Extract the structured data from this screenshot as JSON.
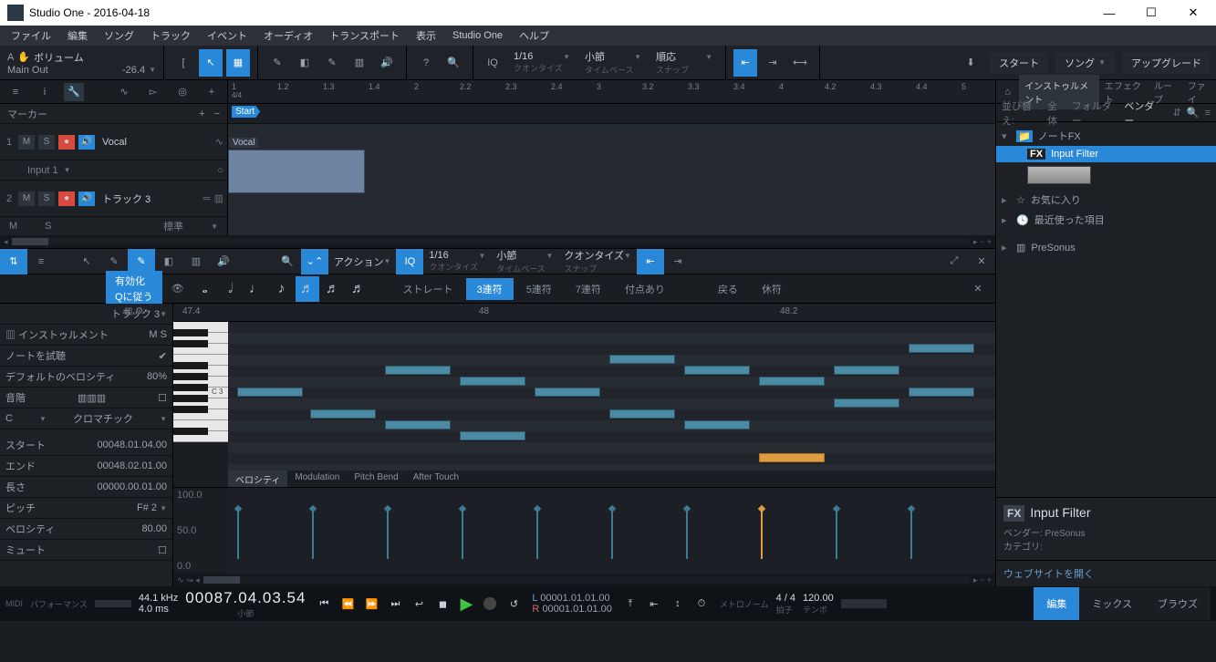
{
  "window": {
    "title": "Studio One - 2016-04-18"
  },
  "menu": [
    "ファイル",
    "編集",
    "ソング",
    "トラック",
    "イベント",
    "オーディオ",
    "トランスポート",
    "表示",
    "Studio One",
    "ヘルプ"
  ],
  "header_left": {
    "mode": "ボリューム",
    "out": "Main Out",
    "level": "-26.4"
  },
  "quantize": {
    "value": "1/16",
    "label": "クオンタイズ"
  },
  "timebase": {
    "value": "小節",
    "label": "タイムベース"
  },
  "snap": {
    "value": "順応",
    "label": "スナップ"
  },
  "top_right": {
    "start": "スタート",
    "song": "ソング",
    "upgrade": "アップグレード"
  },
  "marker": {
    "label": "マーカー",
    "start": "Start"
  },
  "tracks": [
    {
      "num": "1",
      "name": "Vocal",
      "input": "Input 1"
    },
    {
      "num": "2",
      "name": "トラック 3"
    }
  ],
  "track_footer": {
    "m": "M",
    "s": "S",
    "zoom": "標準"
  },
  "piano": {
    "action": "アクション",
    "q_value": "1/16",
    "q_label": "クオンタイズ",
    "tb_value": "小節",
    "tb_label": "タイムベース",
    "sn_value": "クオンタイズ",
    "sn_label": "スナップ",
    "enable": "有効化",
    "follow": "Qに従う",
    "trip": {
      "straight": "ストレート",
      "t3": "3連符",
      "t5": "5連符",
      "t7": "7連符",
      "dotted": "付点あり",
      "back": "戻る",
      "rest": "休符"
    },
    "track": "トラック 3",
    "ruler": {
      "a": "47.4",
      "b": "48",
      "c": "48.2"
    },
    "side": {
      "instr": "インストゥルメント",
      "preview": "ノートを試聴",
      "defvel": "デフォルトのベロシティ",
      "defvel_v": "80%",
      "scale": "音階",
      "c": "C",
      "chrom": "クロマチック",
      "start_l": "スタート",
      "start_v": "00048.01.04.00",
      "end_l": "エンド",
      "end_v": "00048.02.01.00",
      "len_l": "長さ",
      "len_v": "00000.00.01.00",
      "pitch_l": "ピッチ",
      "pitch_v": "F# 2",
      "vel_l": "ベロシティ",
      "vel_v": "80.00",
      "mute_l": "ミュート",
      "m": "M",
      "s": "S"
    },
    "vel_tabs": [
      "ベロシティ",
      "Modulation",
      "Pitch Bend",
      "After Touch"
    ],
    "vel_scale": {
      "a": "100.0",
      "b": "50.0",
      "c": "0.0"
    },
    "key_label": "C 3"
  },
  "browser": {
    "tabs": [
      "インストゥルメント",
      "エフェクト",
      "ループ",
      "ファイ"
    ],
    "sort": {
      "label": "並び替え:",
      "all": "全体",
      "folder": "フォルダー",
      "vendor": "ベンダー"
    },
    "node_fx": "ノートFX",
    "input_filter": "Input Filter",
    "fav": "お気に入り",
    "recent": "最近使った項目",
    "presonus": "PreSonus",
    "info": {
      "fx": "FX",
      "name": "Input Filter",
      "vendor": "ベンダー: PreSonus",
      "cat": "カテゴリ:"
    },
    "link": "ウェブサイトを開く"
  },
  "transport": {
    "midi": "MIDI",
    "perf": "パフォーマンス",
    "rate": "44.1 kHz",
    "lat": "4.0 ms",
    "pos": "00087.04.03.54",
    "pos_l": "小節",
    "l": "00001.01.01.00",
    "r": "00001.01.01.00",
    "metro": "メトロノーム",
    "sig": "4 / 4",
    "sig_l": "拍子",
    "tempo": "120.00",
    "tempo_l": "テンポ",
    "t_edit": "編集",
    "t_mix": "ミックス",
    "t_browse": "ブラウズ"
  },
  "ruler_ticks": [
    "1",
    "1.2",
    "1.3",
    "1.4",
    "2",
    "2.2",
    "2.3",
    "2.4",
    "3",
    "3.2",
    "3.3",
    "3.4",
    "4",
    "4.2",
    "4.3",
    "4.4",
    "5"
  ],
  "ruler_sig": "4/4"
}
